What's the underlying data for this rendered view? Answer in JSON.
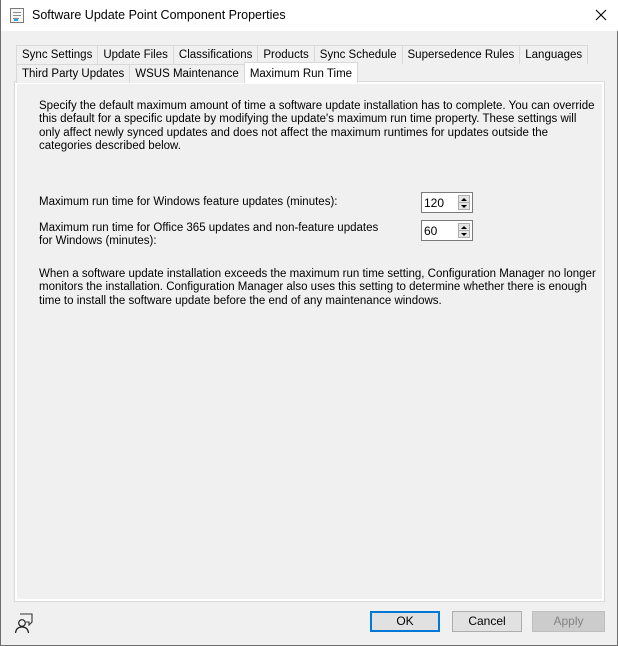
{
  "window": {
    "title": "Software Update Point Component Properties",
    "icon": "properties-window-icon",
    "close_icon": "close-icon"
  },
  "tabs": {
    "row1": [
      {
        "label": "Sync Settings",
        "active": false
      },
      {
        "label": "Update Files",
        "active": false
      },
      {
        "label": "Classifications",
        "active": false
      },
      {
        "label": "Products",
        "active": false
      },
      {
        "label": "Sync Schedule",
        "active": false
      },
      {
        "label": "Supersedence Rules",
        "active": false
      },
      {
        "label": "Languages",
        "active": false
      }
    ],
    "row2": [
      {
        "label": "Third Party Updates",
        "active": false
      },
      {
        "label": "WSUS Maintenance",
        "active": false
      },
      {
        "label": "Maximum Run Time",
        "active": true
      }
    ]
  },
  "content": {
    "intro": "Specify the default maximum amount of time a software update installation has to complete. You can override this default for a specific update by modifying the update's maximum run time property. These settings will only affect newly synced updates and does not affect the maximum runtimes for updates outside the categories described below.",
    "settings": [
      {
        "label": "Maximum run time for Windows feature updates (minutes):",
        "value": "120"
      },
      {
        "label": "Maximum run time for Office 365 updates and non-feature updates for Windows (minutes):",
        "value": "60"
      }
    ],
    "note": "When a software update installation exceeds the maximum run time setting, Configuration Manager no longer monitors the installation. Configuration Manager also uses this setting to determine whether there is enough time to install the software update before the end of any maintenance windows."
  },
  "footer": {
    "help_icon": "user-feedback-icon",
    "ok_label": "OK",
    "cancel_label": "Cancel",
    "apply_label": "Apply",
    "apply_enabled": false,
    "accent_color": "#0078d7"
  }
}
